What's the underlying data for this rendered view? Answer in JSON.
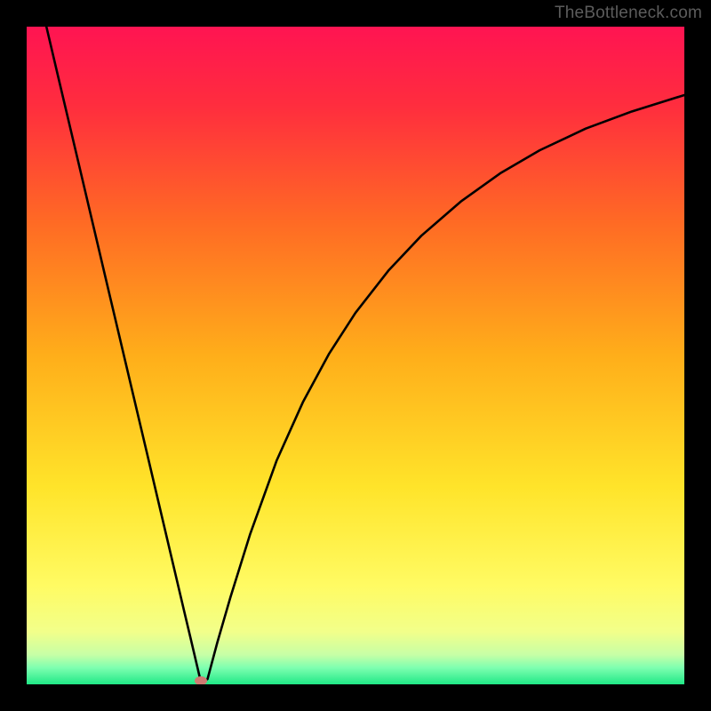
{
  "watermark": "TheBottleneck.com",
  "colors": {
    "frame": "#000000",
    "marker": "#cf7a72",
    "curve": "#000000",
    "gradient_stops": [
      {
        "pos": 0.0,
        "color": "#ff1452"
      },
      {
        "pos": 0.12,
        "color": "#ff2d3e"
      },
      {
        "pos": 0.3,
        "color": "#ff6b24"
      },
      {
        "pos": 0.5,
        "color": "#ffae1a"
      },
      {
        "pos": 0.7,
        "color": "#ffe42a"
      },
      {
        "pos": 0.85,
        "color": "#fffb63"
      },
      {
        "pos": 0.92,
        "color": "#f2ff8a"
      },
      {
        "pos": 0.955,
        "color": "#c7ffa6"
      },
      {
        "pos": 0.975,
        "color": "#7dffb0"
      },
      {
        "pos": 1.0,
        "color": "#20e886"
      }
    ]
  },
  "chart_data": {
    "type": "line",
    "title": "",
    "xlabel": "",
    "ylabel": "",
    "xlim": [
      0,
      100
    ],
    "ylim": [
      0,
      100
    ],
    "series": [
      {
        "name": "curve",
        "x": [
          3,
          5,
          8,
          10,
          12,
          15,
          18,
          20,
          22,
          24,
          25,
          26.5,
          27.5,
          29,
          31,
          34,
          38,
          42,
          46,
          50,
          55,
          60,
          66,
          72,
          78,
          85,
          92,
          100
        ],
        "y": [
          100,
          91.5,
          78.8,
          70.3,
          61.8,
          49.1,
          36.4,
          27.9,
          19.4,
          10.9,
          6.7,
          0.3,
          0.8,
          6.4,
          13.3,
          22.9,
          34.0,
          42.9,
          50.3,
          56.5,
          62.9,
          68.2,
          73.4,
          77.7,
          81.2,
          84.5,
          87.1,
          89.6
        ]
      }
    ],
    "marker": {
      "x": 26.5,
      "y": 0.5
    },
    "annotations": []
  }
}
